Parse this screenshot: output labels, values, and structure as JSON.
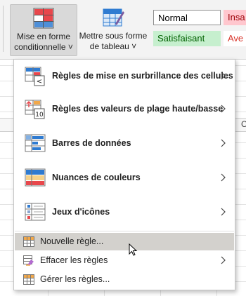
{
  "ribbon": {
    "conditional_formatting": {
      "line1": "Mise en forme",
      "line2": "conditionnelle ˅"
    },
    "format_as_table": {
      "line1": "Mettre sous forme",
      "line2": "de tableau ˅"
    },
    "cell_styles": {
      "normal": "Normal",
      "bad": "Insa",
      "good": "Satisfaisant",
      "neutral": "Ave"
    }
  },
  "sheet": {
    "column_letter": "C"
  },
  "menu": {
    "items": [
      {
        "label": "Règles de mise en surbrillance des cellules",
        "icon": "highlight-rules-icon",
        "submenu": true
      },
      {
        "label": "Règles des valeurs de plage haute/basse",
        "icon": "top-bottom-rules-icon",
        "submenu": true
      },
      {
        "label": "Barres de données",
        "icon": "data-bars-icon",
        "submenu": true
      },
      {
        "label": "Nuances de couleurs",
        "icon": "color-scales-icon",
        "submenu": true
      },
      {
        "label": "Jeux d'icônes",
        "icon": "icon-sets-icon",
        "submenu": true
      },
      {
        "label": "Nouvelle règle...",
        "icon": "new-rule-icon",
        "submenu": false,
        "hovered": true
      },
      {
        "label": "Effacer les règles",
        "icon": "clear-rules-icon",
        "submenu": true
      },
      {
        "label": "Gérer les règles...",
        "icon": "manage-rules-icon",
        "submenu": false
      }
    ]
  },
  "colors": {
    "accent_red": "#e8474c",
    "accent_blue": "#2f7bd1",
    "hover": "#d3d1cd"
  }
}
